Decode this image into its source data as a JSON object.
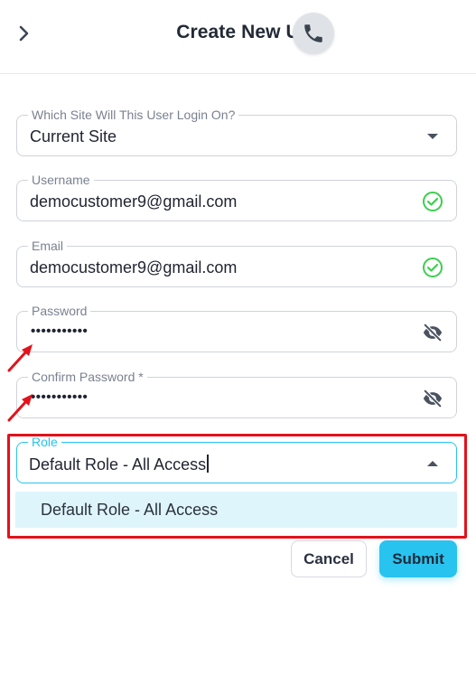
{
  "header": {
    "title": "Create New U"
  },
  "form": {
    "site": {
      "label": "Which Site Will This User Login On?",
      "value": "Current Site"
    },
    "username": {
      "label": "Username",
      "value": "democustomer9@gmail.com"
    },
    "email": {
      "label": "Email",
      "value": "democustomer9@gmail.com"
    },
    "password": {
      "label": "Password",
      "value": "•••••••••••"
    },
    "confirm_password": {
      "label": "Confirm Password *",
      "value": "•••••••••••"
    },
    "role": {
      "label": "Role",
      "value": "Default Role - All Access"
    }
  },
  "dropdown": {
    "options": [
      "Default Role - All Access"
    ]
  },
  "actions": {
    "cancel_label": "Cancel",
    "submit_label": "Submit"
  },
  "colors": {
    "accent": "#29c3f0",
    "valid": "#3ccf4e",
    "annotation": "#e3121b"
  },
  "icons": {
    "back": "chevron-right-icon",
    "phone": "phone-icon",
    "select": "caret-down-icon",
    "valid": "check-circle-icon",
    "visibility": "eye-off-icon"
  }
}
